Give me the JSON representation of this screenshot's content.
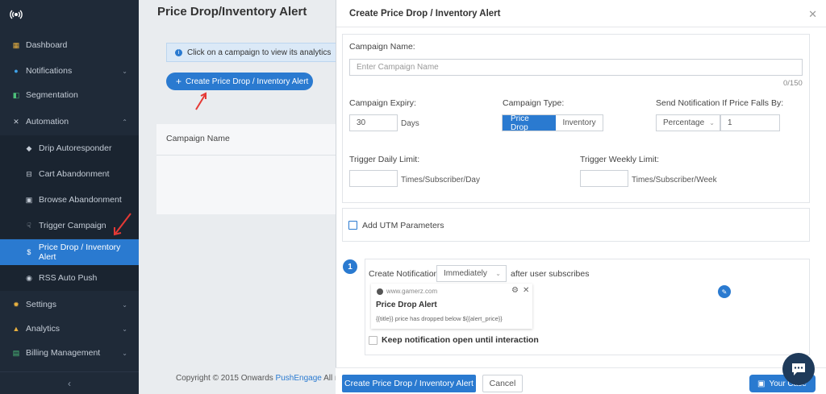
{
  "sidebar": {
    "items": [
      {
        "label": "Dashboard",
        "icon": "dashboard-icon"
      },
      {
        "label": "Notifications",
        "icon": "bell-icon"
      },
      {
        "label": "Segmentation",
        "icon": "segment-icon"
      },
      {
        "label": "Automation",
        "icon": "automation-icon"
      },
      {
        "label": "Drip Autoresponder",
        "icon": "drip-icon"
      },
      {
        "label": "Cart Abandonment",
        "icon": "cart-icon"
      },
      {
        "label": "Browse Abandonment",
        "icon": "browse-icon"
      },
      {
        "label": "Trigger Campaign",
        "icon": "trigger-icon"
      },
      {
        "label": "Price Drop / Inventory Alert",
        "icon": "dollar-icon"
      },
      {
        "label": "RSS Auto Push",
        "icon": "rss-icon"
      },
      {
        "label": "Settings",
        "icon": "gear-icon"
      },
      {
        "label": "Analytics",
        "icon": "analytics-icon"
      },
      {
        "label": "Billing Management",
        "icon": "billing-icon"
      }
    ]
  },
  "page": {
    "title": "Price Drop/Inventory Alert",
    "info": "Click on a campaign to view its analytics",
    "create_button": "Create Price Drop / Inventory Alert",
    "col_campaign_name": "Campaign Name",
    "footer_prefix": "Copyright © 2015 Onwards",
    "footer_link": "PushEngage",
    "footer_suffix": "All ri"
  },
  "modal": {
    "title": "Create Price Drop / Inventory Alert",
    "campaign_name_label": "Campaign Name:",
    "campaign_name_placeholder": "Enter Campaign Name",
    "campaign_name_counter": "0/150",
    "expiry_label": "Campaign Expiry:",
    "expiry_value": "30",
    "expiry_unit": "Days",
    "type_label": "Campaign Type:",
    "type_options": [
      "Price Drop",
      "Inventory"
    ],
    "type_selected": "Price Drop",
    "price_fall_label": "Send Notification If Price Falls By:",
    "price_fall_select": "Percentage",
    "price_fall_value": "1",
    "daily_limit_label": "Trigger Daily Limit:",
    "daily_limit_unit": "Times/Subscriber/Day",
    "weekly_limit_label": "Trigger Weekly Limit:",
    "weekly_limit_unit": "Times/Subscriber/Week",
    "utm_label": "Add UTM Parameters",
    "step_number": "1",
    "create_notification_label": "Create Notification",
    "timing_select": "Immediately",
    "after_text": "after user subscribes",
    "notif_site": "www.gamerz.com",
    "notif_title": "Price Drop Alert",
    "notif_body": "{{title}} price has dropped below ${{alert_price}}",
    "keep_open_label": "Keep notification open until interaction",
    "submit_button": "Create Price Drop / Inventory Alert",
    "cancel_button": "Cancel",
    "your_case": "Your Case"
  },
  "colors": {
    "sidebar_bg": "#1f2a38",
    "accent": "#2a7ad0",
    "arrow": "#e53935"
  }
}
